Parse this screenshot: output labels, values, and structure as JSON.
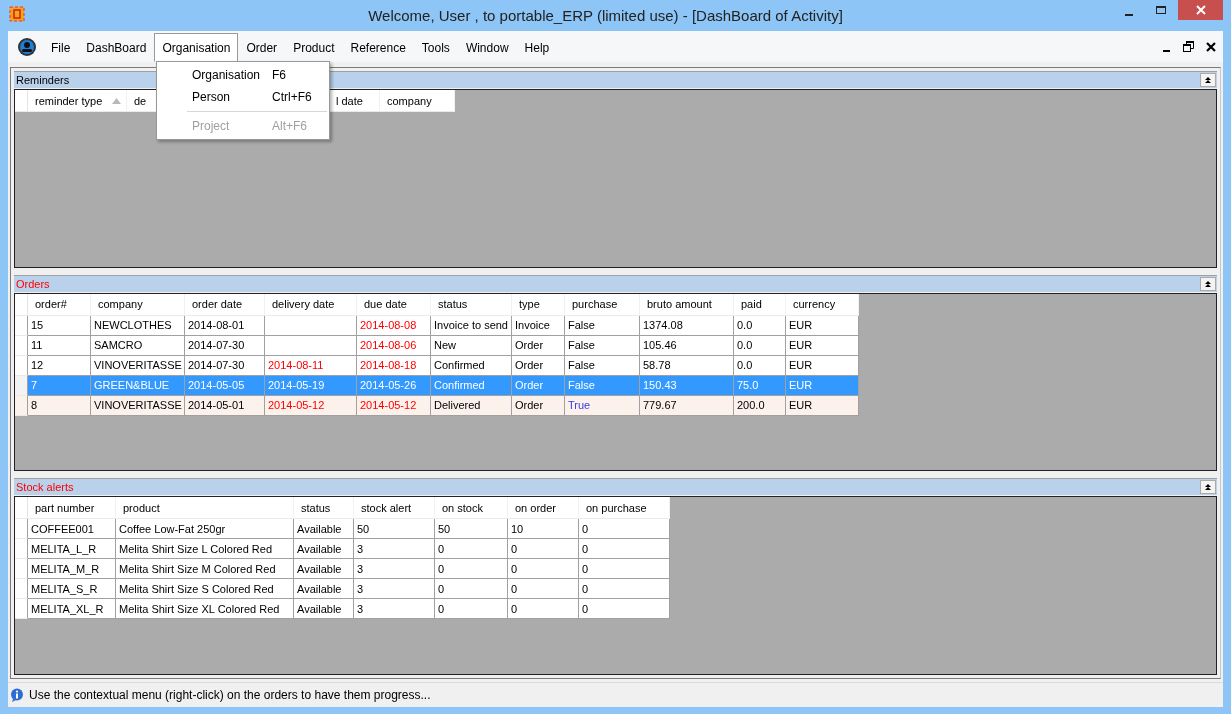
{
  "window": {
    "title": "Welcome, User , to portable_ERP (limited use) - [DashBoard of Activity]"
  },
  "menubar": [
    {
      "label": "File",
      "selected": false
    },
    {
      "label": "DashBoard",
      "selected": false
    },
    {
      "label": "Organisation",
      "selected": true
    },
    {
      "label": "Order",
      "selected": false
    },
    {
      "label": "Product",
      "selected": false
    },
    {
      "label": "Reference",
      "selected": false
    },
    {
      "label": "Tools",
      "selected": false
    },
    {
      "label": "Window",
      "selected": false
    },
    {
      "label": "Help",
      "selected": false
    }
  ],
  "open_menu": [
    {
      "kind": "item",
      "label": "Organisation",
      "shortcut": "F6",
      "disabled": false
    },
    {
      "kind": "item",
      "label": "Person",
      "shortcut": "Ctrl+F6",
      "disabled": false
    },
    {
      "kind": "separator"
    },
    {
      "kind": "item",
      "label": "Project",
      "shortcut": "Alt+F6",
      "disabled": true
    }
  ],
  "reminders": {
    "title": "Reminders",
    "color": "#000000",
    "columns": [
      "reminder type",
      "de",
      "l date",
      "company"
    ]
  },
  "orders": {
    "title": "Orders",
    "color": "#ff0000",
    "columns": [
      "order#",
      "company",
      "order date",
      "delivery date",
      "due date",
      "status",
      "type",
      "purchase",
      "bruto amount",
      "paid",
      "currency"
    ],
    "rows": [
      {
        "selected": false,
        "tinted": false,
        "delivery_overdue": false,
        "due_overdue": true,
        "purchase_marked": false,
        "cells": [
          "15",
          "NEWCLOTHES",
          "2014-08-01",
          null,
          "2014-08-08",
          "Invoice to send",
          "Invoice",
          "False",
          "1374.08",
          "0.0",
          "EUR"
        ]
      },
      {
        "selected": false,
        "tinted": false,
        "delivery_overdue": false,
        "due_overdue": true,
        "purchase_marked": false,
        "cells": [
          "11",
          "SAMCRO",
          "2014-07-30",
          null,
          "2014-08-06",
          "New",
          "Order",
          "False",
          "105.46",
          "0.0",
          "EUR"
        ]
      },
      {
        "selected": false,
        "tinted": false,
        "delivery_overdue": true,
        "due_overdue": true,
        "purchase_marked": false,
        "cells": [
          "12",
          "VINOVERITASSE",
          "2014-07-30",
          "2014-08-11",
          "2014-08-18",
          "Confirmed",
          "Order",
          "False",
          "58.78",
          "0.0",
          "EUR"
        ]
      },
      {
        "selected": true,
        "tinted": false,
        "delivery_overdue": false,
        "due_overdue": false,
        "purchase_marked": false,
        "cells": [
          "7",
          "GREEN&BLUE",
          "2014-05-05",
          "2014-05-19",
          "2014-05-26",
          "Confirmed",
          "Order",
          "False",
          "150.43",
          "75.0",
          "EUR"
        ]
      },
      {
        "selected": false,
        "tinted": true,
        "delivery_overdue": true,
        "due_overdue": true,
        "purchase_marked": true,
        "cells": [
          "8",
          "VINOVERITASSE",
          "2014-05-01",
          "2014-05-12",
          "2014-05-12",
          "Delivered",
          "Order",
          "True",
          "779.67",
          "200.0",
          "EUR"
        ]
      }
    ]
  },
  "stock_alerts": {
    "title": "Stock alerts",
    "color": "#ff0000",
    "columns": [
      "part number",
      "product",
      "status",
      "stock alert",
      "on stock",
      "on order",
      "on purchase"
    ],
    "rows": [
      [
        "COFFEE001",
        "Coffee Low-Fat 250gr",
        "Available",
        "50",
        "50",
        "10",
        "0"
      ],
      [
        "MELITA_L_R",
        "Melita Shirt Size L Colored Red",
        "Available",
        "3",
        "0",
        "0",
        "0"
      ],
      [
        "MELITA_M_R",
        "Melita Shirt Size M Colored Red",
        "Available",
        "3",
        "0",
        "0",
        "0"
      ],
      [
        "MELITA_S_R",
        "Melita Shirt Size S Colored Red",
        "Available",
        "3",
        "0",
        "0",
        "0"
      ],
      [
        "MELITA_XL_R",
        "Melita Shirt Size XL Colored Red",
        "Available",
        "3",
        "0",
        "0",
        "0"
      ]
    ]
  },
  "status_bar": "Use the contextual menu (right-click) on the orders to have them progress..."
}
